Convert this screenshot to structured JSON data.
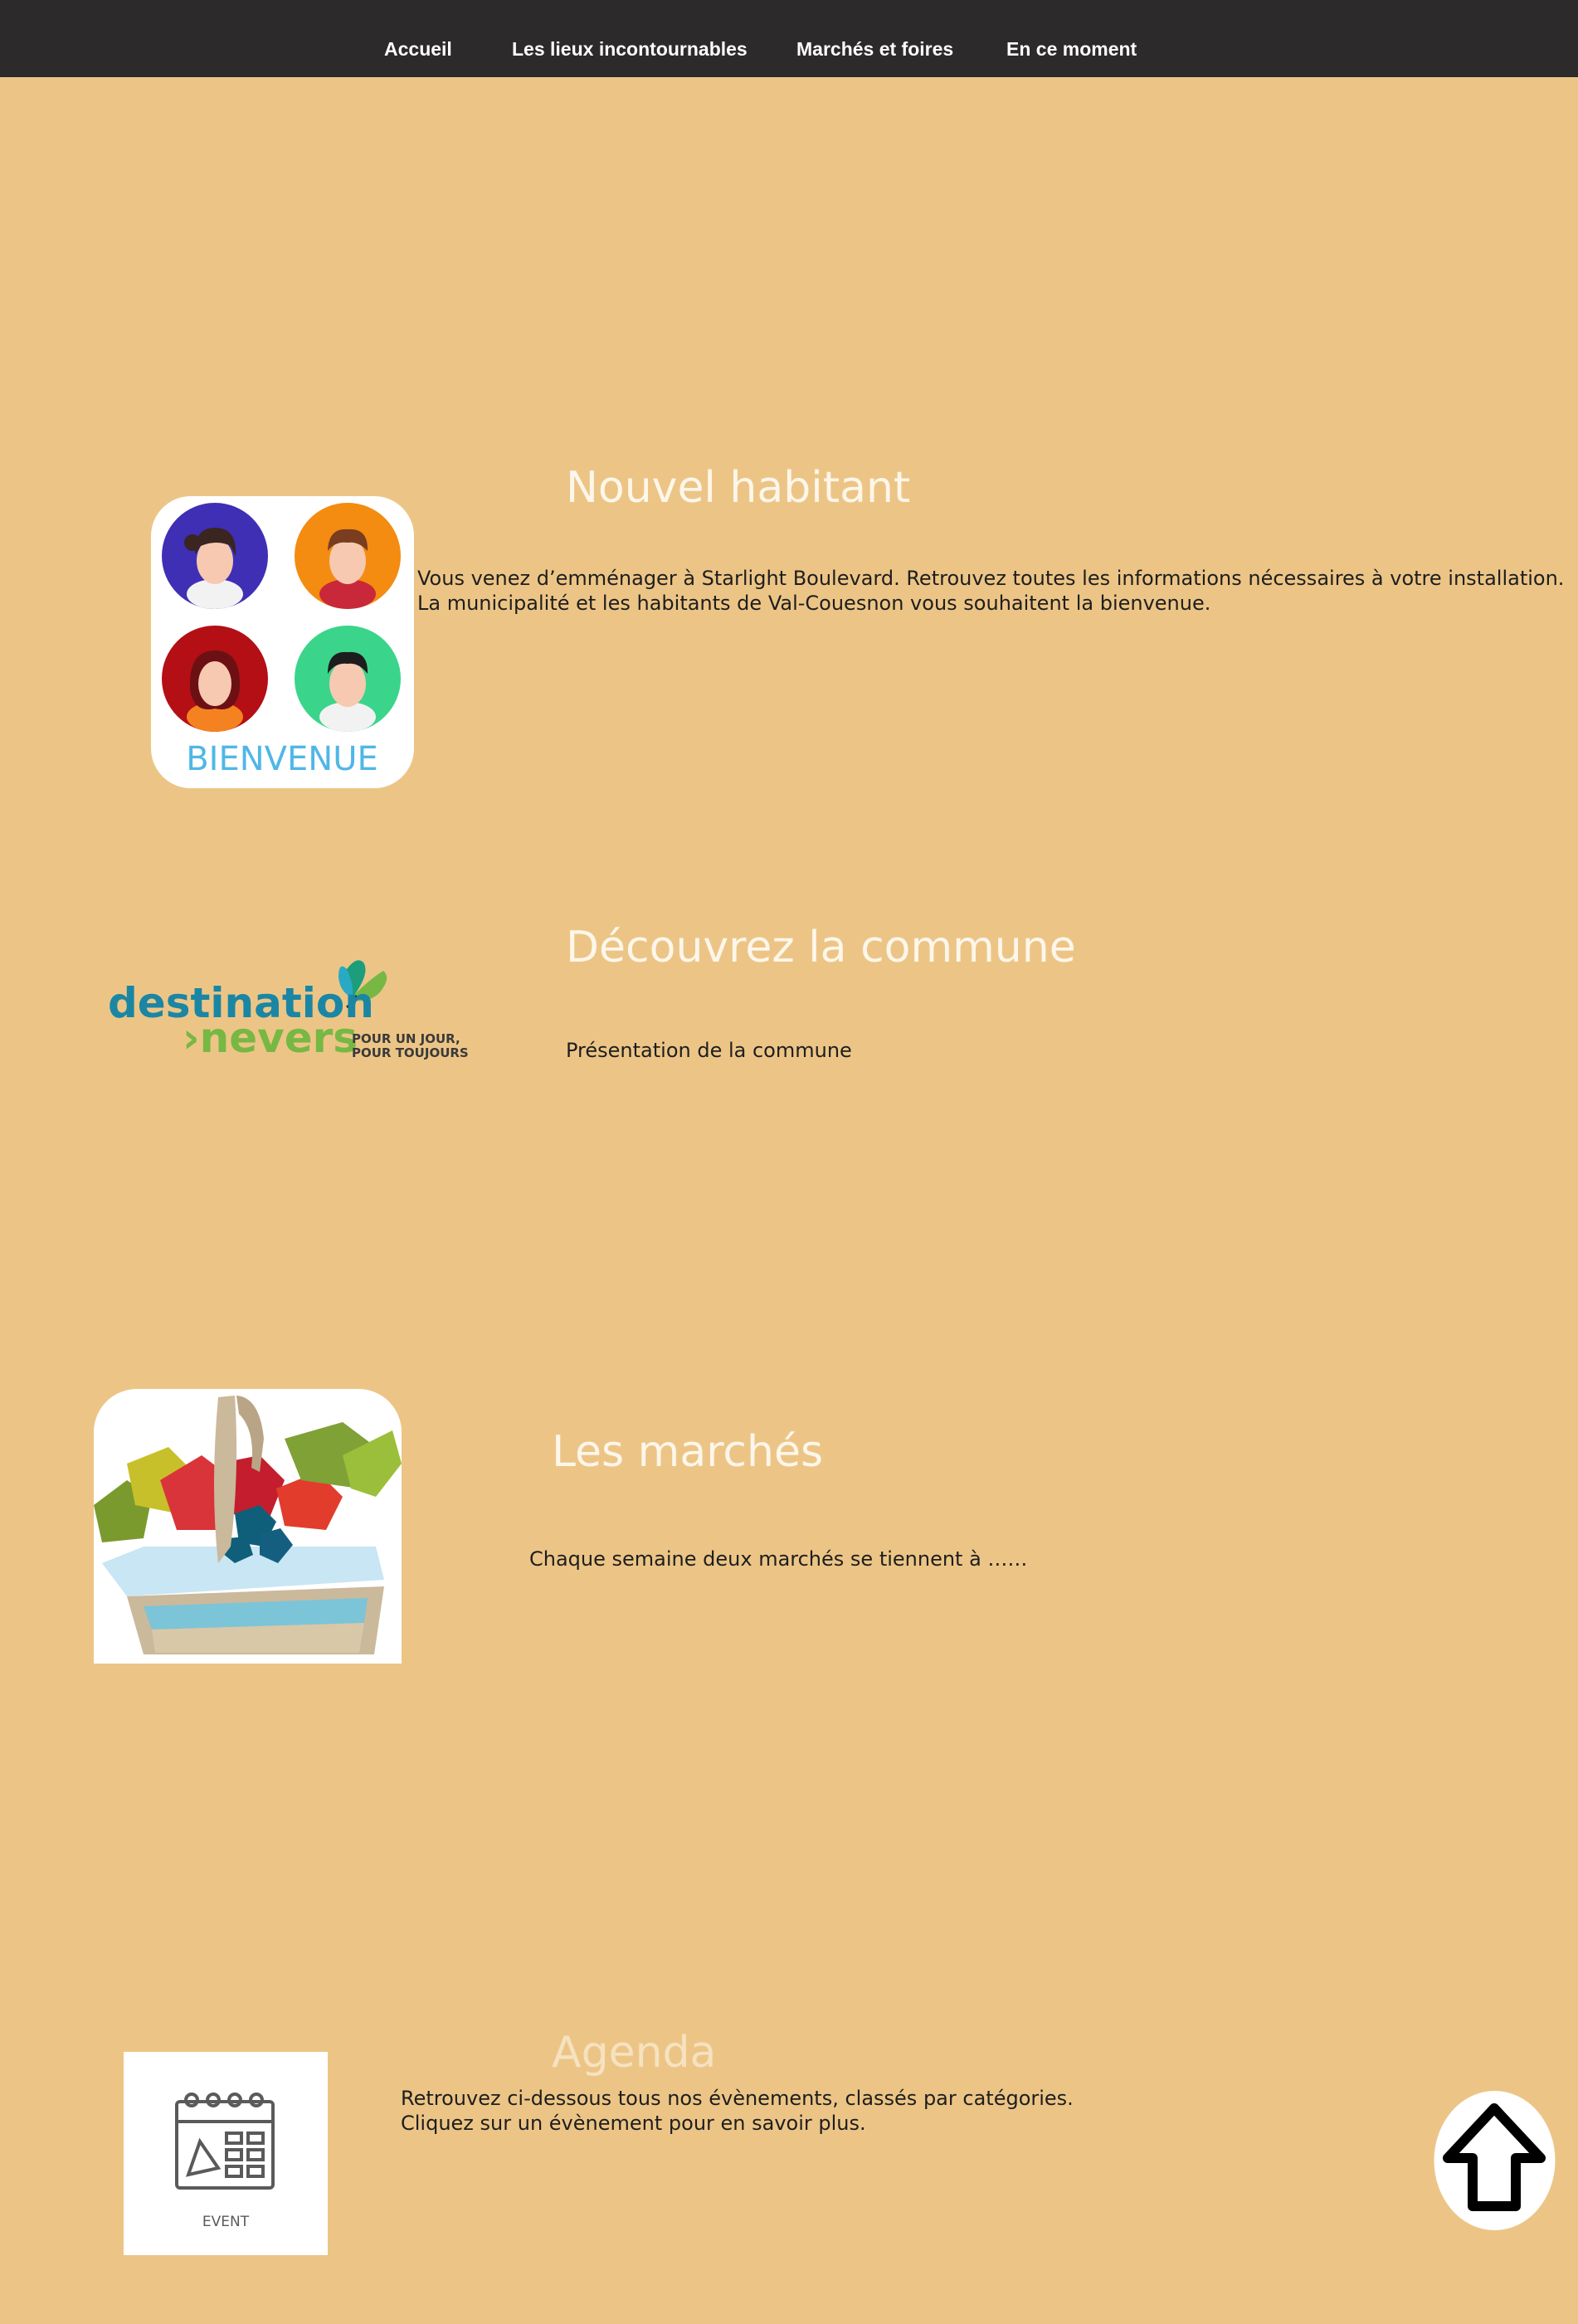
{
  "nav": {
    "items": [
      {
        "label": "Accueil"
      },
      {
        "label": "Les lieux incontournables"
      },
      {
        "label": "Marchés et foires"
      },
      {
        "label": "En ce moment"
      }
    ]
  },
  "nouvel_habitant": {
    "title": "Nouvel habitant",
    "line1": "Vous venez d’emménager à Starlight Boulevard. Retrouvez toutes les informations nécessaires à votre installation.",
    "line2": "La municipalité et les habitants de Val-Couesnon vous souhaitent la bienvenue.",
    "image_caption": "BIENVENUE"
  },
  "commune": {
    "title": "Découvrez la commune",
    "text": "Présentation de la commune",
    "logo": {
      "line1": "destination",
      "line2": "›nevers",
      "tagline1": "POUR UN JOUR,",
      "tagline2": "POUR TOUJOURS"
    }
  },
  "marches": {
    "title": "Les marchés",
    "text": "Chaque semaine deux marchés se tiennent à ……"
  },
  "agenda": {
    "title": "Agenda",
    "line1": "Retrouvez ci-dessous tous nos évènements, classés par catégories.",
    "line2": "Cliquez sur un évènement pour en savoir plus.",
    "image_caption": "EVENT"
  },
  "icons": {
    "scroll_top": "arrow-up-icon"
  },
  "colors": {
    "background": "#ecc586",
    "nav_bg": "#2d2a2b",
    "title": "#fdf6ea"
  }
}
